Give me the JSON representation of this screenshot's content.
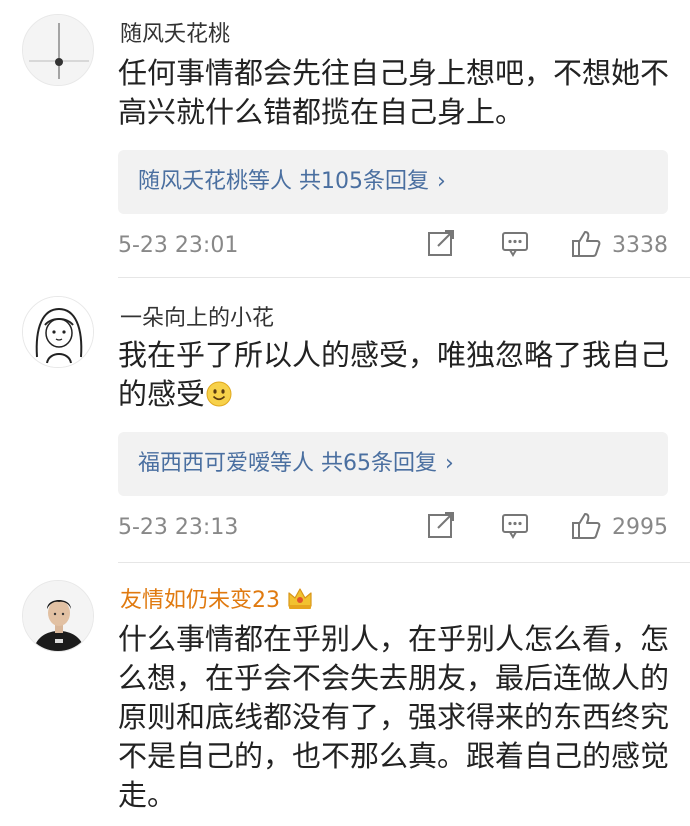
{
  "comments": [
    {
      "username": "随风夭花桃",
      "text": "任何事情都会先往自己身上想吧，不想她不高兴就什么错都揽在自己身上。",
      "reply_summary": "随风夭花桃等人 共105条回复",
      "time": "5-23 23:01",
      "likes": "3338"
    },
    {
      "username": "一朵向上的小花",
      "text": "我在乎了所以人的感受，唯独忽略了我自己的感受",
      "reply_summary": "福西西可爱嗳等人 共65条回复",
      "time": "5-23 23:13",
      "likes": "2995"
    },
    {
      "username": "友情如仍未变23",
      "text": "什么事情都在乎别人，在乎别人怎么看，怎么想，在乎会不会失去朋友，最后连做人的原则和底线都没有了，强求得来的东西终究不是自己的，也不那么真。跟着自己的感觉走。"
    }
  ],
  "icons": {
    "reply_arrow": "chevron-right-icon",
    "share": "share-edit-icon",
    "comment": "comment-icon",
    "like": "thumbs-up-icon",
    "vip": "crown-icon",
    "emoji": "smile-emoji-icon"
  },
  "colors": {
    "link": "#4a6fa0",
    "vip_name": "#e07a10",
    "meta": "#888888",
    "reply_bg": "#f2f2f2"
  }
}
